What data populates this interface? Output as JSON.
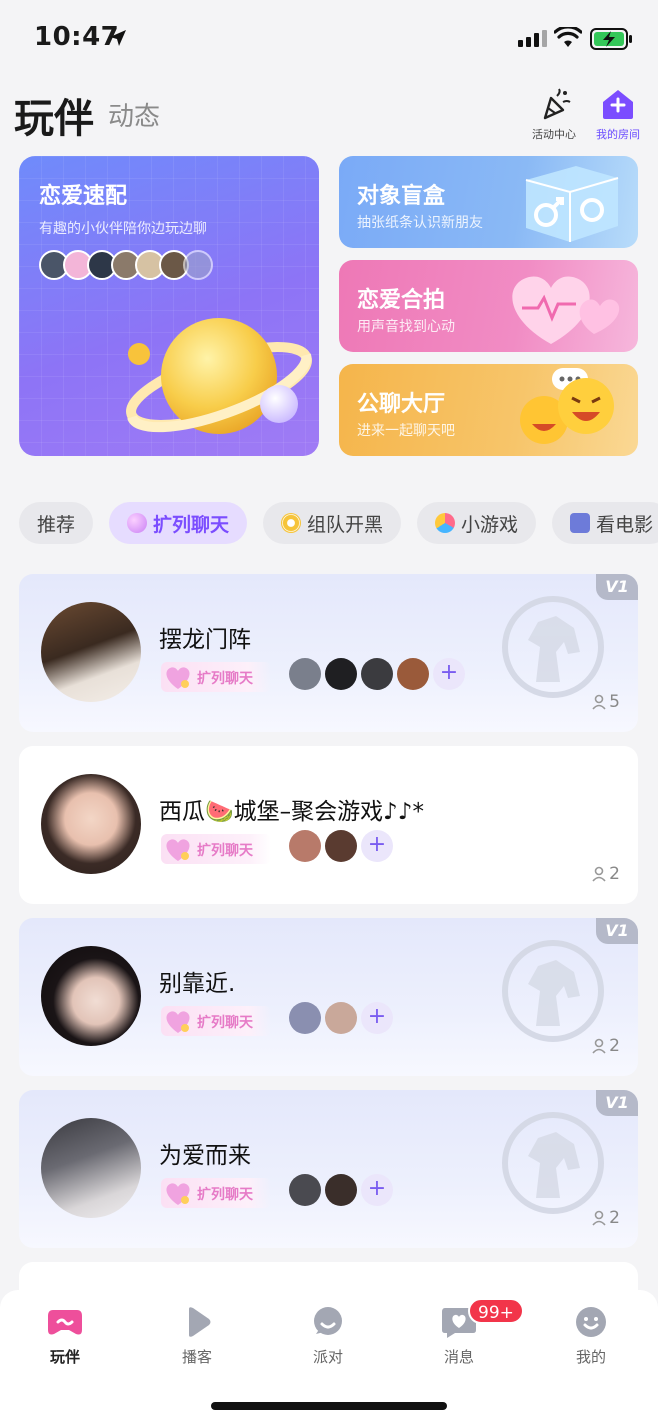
{
  "status_bar": {
    "time": "10:47"
  },
  "header": {
    "title": "玩伴",
    "subtitle": "动态",
    "actions": [
      {
        "label": "活动中心",
        "icon": "party-popper-icon"
      },
      {
        "label": "我的房间",
        "icon": "home-plus-icon"
      }
    ]
  },
  "features": {
    "big": {
      "title": "恋爱速配",
      "desc": "有趣的小伙伴陪你边玩边聊"
    },
    "small": [
      {
        "title": "对象盲盒",
        "desc": "抽张纸条认识新朋友"
      },
      {
        "title": "恋爱合拍",
        "desc": "用声音找到心动"
      },
      {
        "title": "公聊大厅",
        "desc": "进来一起聊天吧"
      }
    ]
  },
  "categories": [
    {
      "label": "推荐"
    },
    {
      "label": "扩列聊天"
    },
    {
      "label": "组队开黑"
    },
    {
      "label": "小游戏"
    },
    {
      "label": "看电影"
    }
  ],
  "rooms": [
    {
      "name": "摆龙门阵",
      "tag": "扩列聊天",
      "count": "5",
      "badge": "V1"
    },
    {
      "name": "西瓜🍉城堡–聚会游戏♪♪*",
      "tag": "扩列聊天",
      "count": "2"
    },
    {
      "name": "别靠近.",
      "tag": "扩列聊天",
      "count": "2",
      "badge": "V1"
    },
    {
      "name": "为爱而来",
      "tag": "扩列聊天",
      "count": "2",
      "badge": "V1"
    }
  ],
  "add_symbol": "+",
  "bottom_nav": [
    {
      "label": "玩伴",
      "icon": "gamepad-icon"
    },
    {
      "label": "播客",
      "icon": "play-icon"
    },
    {
      "label": "派对",
      "icon": "chat-bubble-icon"
    },
    {
      "label": "消息",
      "icon": "message-heart-icon",
      "badge": "99+"
    },
    {
      "label": "我的",
      "icon": "smiley-icon"
    }
  ],
  "colors": {
    "accent": "#7b4dff",
    "badge_red": "#f2354a",
    "tag_pink": "#e67bc7"
  }
}
